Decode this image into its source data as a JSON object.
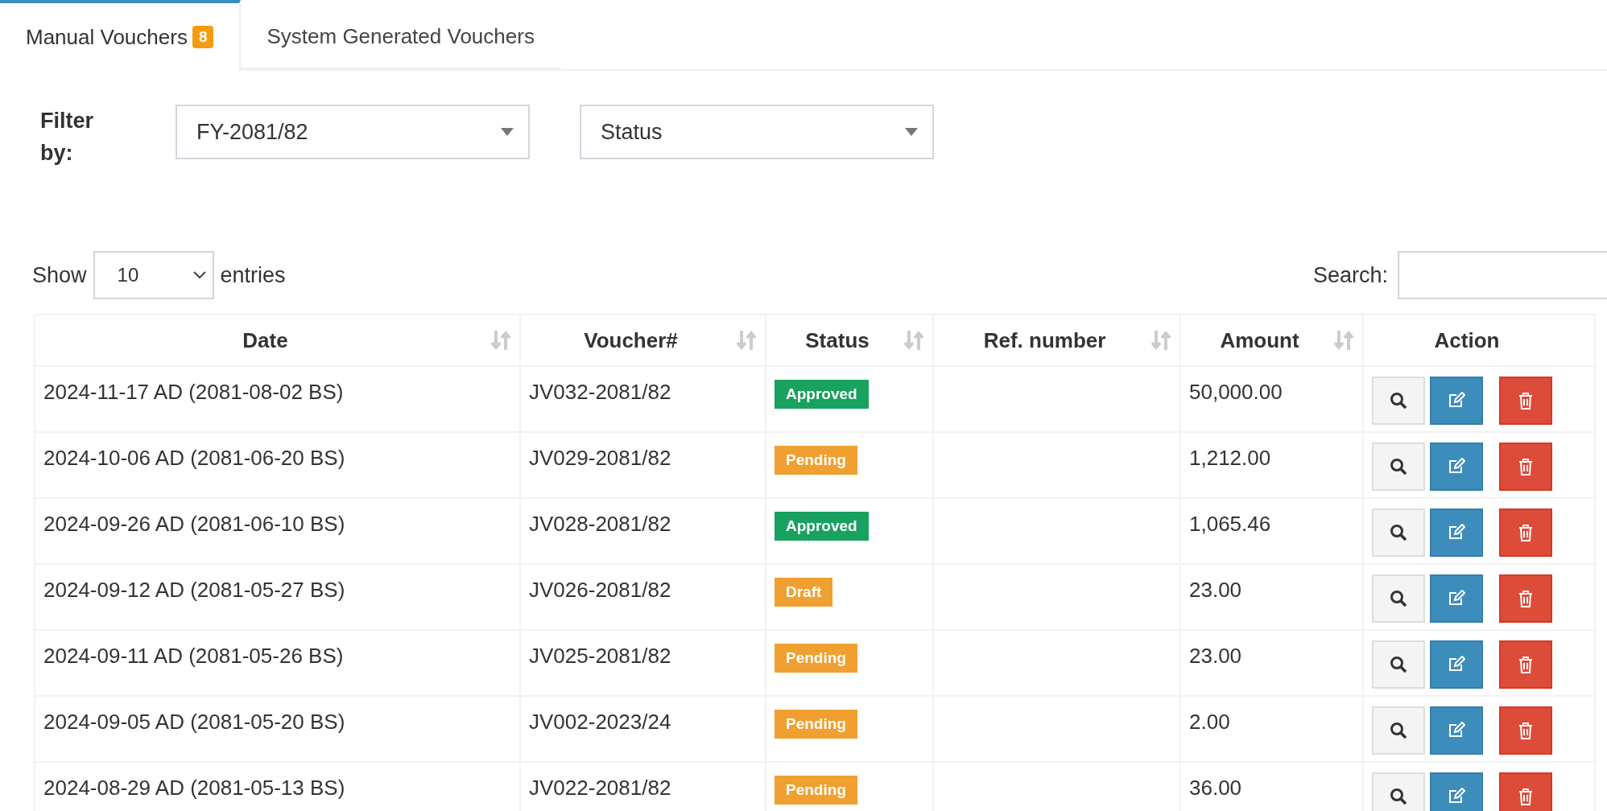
{
  "tabs": [
    {
      "label": "Manual Vouchers",
      "badge": "8",
      "selected": true
    },
    {
      "label": "System Generated Vouchers",
      "selected": false
    }
  ],
  "filter": {
    "label": "Filter by:",
    "selects": [
      {
        "value": "FY-2081/82"
      },
      {
        "value": "Status"
      }
    ]
  },
  "length_control": {
    "before": "Show",
    "value": "10",
    "after": "entries"
  },
  "search": {
    "label": "Search:"
  },
  "table": {
    "columns": [
      {
        "label": "Date",
        "sortable": true
      },
      {
        "label": "Voucher#",
        "sortable": true
      },
      {
        "label": "Status",
        "sortable": true
      },
      {
        "label": "Ref. number",
        "sortable": true
      },
      {
        "label": "Amount",
        "sortable": true
      },
      {
        "label": "Action",
        "sortable": false
      }
    ],
    "rows": [
      {
        "date": "2024-11-17 AD (2081-08-02 BS)",
        "voucher": "JV032-2081/82",
        "status": "Approved",
        "color": "#19a15f",
        "amount": "50,000.00"
      },
      {
        "date": "2024-10-06 AD (2081-06-20 BS)",
        "voucher": "JV029-2081/82",
        "status": "Pending",
        "color": "#f0a030",
        "amount": "1,212.00"
      },
      {
        "date": "2024-09-26 AD (2081-06-10 BS)",
        "voucher": "JV028-2081/82",
        "status": "Approved",
        "color": "#19a15f",
        "amount": "1,065.46"
      },
      {
        "date": "2024-09-12 AD (2081-05-27 BS)",
        "voucher": "JV026-2081/82",
        "status": "Draft",
        "color": "#f0a030",
        "amount": "23.00"
      },
      {
        "date": "2024-09-11 AD (2081-05-26 BS)",
        "voucher": "JV025-2081/82",
        "status": "Pending",
        "color": "#f0a030",
        "amount": "23.00"
      },
      {
        "date": "2024-09-05 AD (2081-05-20 BS)",
        "voucher": "JV002-2023/24",
        "status": "Pending",
        "color": "#f0a030",
        "amount": "2.00"
      },
      {
        "date": "2024-08-29 AD (2081-05-13 BS)",
        "voucher": "JV022-2081/82",
        "status": "Pending",
        "color": "#f0a030",
        "amount": "36.00"
      }
    ]
  }
}
